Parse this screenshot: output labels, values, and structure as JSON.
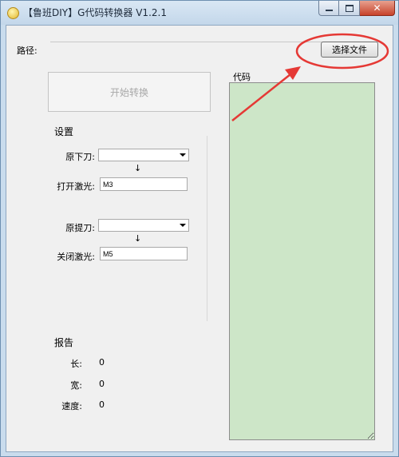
{
  "window": {
    "title": "【鲁班DIY】G代码转换器 V1.2.1"
  },
  "path": {
    "label": "路径:"
  },
  "choose_button": {
    "label": "选择文件"
  },
  "start_button": {
    "label": "开始转换"
  },
  "settings": {
    "title": "设置",
    "pen_down_label": "原下刀:",
    "laser_on_label": "打开激光:",
    "laser_on_value": "M3",
    "pen_up_label": "原提刀:",
    "laser_off_label": "关闭激光:",
    "laser_off_value": "M5",
    "arrow": "↓"
  },
  "report": {
    "title": "报告",
    "items": [
      {
        "label": "长:",
        "value": "0"
      },
      {
        "label": "宽:",
        "value": "0"
      },
      {
        "label": "速度:",
        "value": "0"
      }
    ]
  },
  "code": {
    "title": "代码"
  },
  "annotation": {
    "color": "#e53935"
  }
}
